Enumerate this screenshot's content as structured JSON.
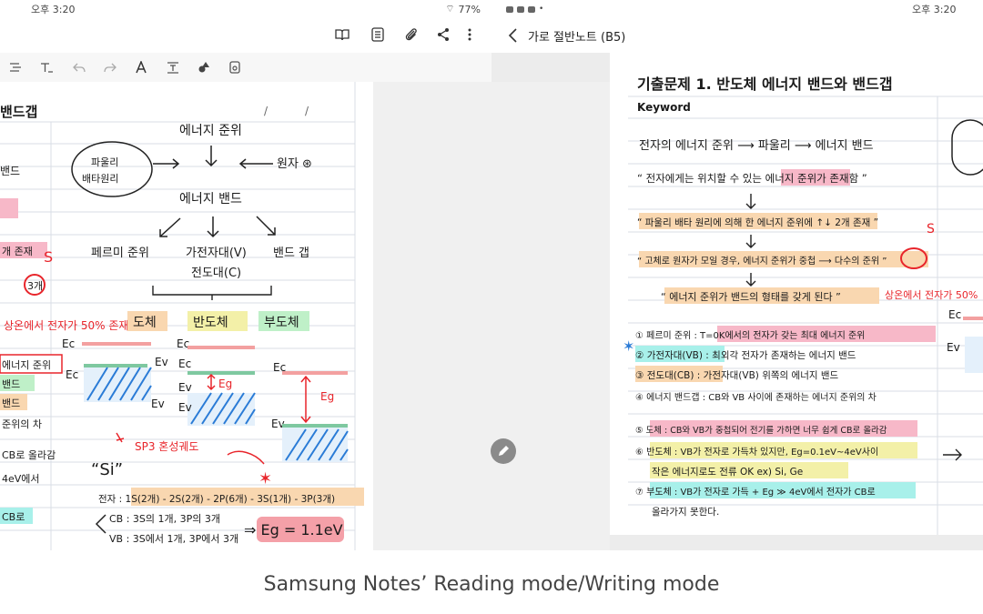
{
  "status_left": {
    "time": "오후 3:20",
    "battery": "77%"
  },
  "status_right": {
    "time": "오후 3:20"
  },
  "note_title": "가로 절반노트 (B5)",
  "left_page": {
    "title_fragment": "밴드갭",
    "energy_level": "에너지 준위",
    "pauli": "파울리\n배타원리",
    "atom": "원자 ⊛",
    "energy_band": "에너지 밴드",
    "fermi": "페르미 준위",
    "valence": "가전자대(V)",
    "conduction": "전도대(C)",
    "bandgap": "밴드 갭",
    "conductor": "도체",
    "semiconductor": "반도체",
    "insulator": "부도체",
    "room_temp": "상온에서 전자가 50% 존재",
    "ec": "Ec",
    "ev": "Ev",
    "eg": "Eg",
    "sp3": "SP3 혼성궤도",
    "si": "“Si”",
    "electron_config": "전자 : 1S(2개) - 2S(2개) - 2P(6개) - 3S(1개) - 3P(3개)",
    "cb_line": "CB : 3S의 1개, 3P의 3개",
    "vb_line": "VB : 3S에서 1개, 3P에서 3개",
    "eg_value": "⇒ Eg = 1.1eV",
    "frag_1": "밴드",
    "frag_2": "개 존재",
    "frag_3": "3개",
    "frag_4": "에너지 준위",
    "frag_5": "밴드",
    "frag_6": "밴드",
    "frag_7": "준위의 차",
    "frag_8": "CB로 올라감",
    "frag_9": "4eV에서",
    "frag_10": "CB로"
  },
  "right_page": {
    "heading": "기출문제 1. 반도체 에너지 밴드와 밴드갭",
    "keyword": "Keyword",
    "line1": "전자의 에너지 준위 ⟶ 파울리 ⟶ 에너지 밴드",
    "line2": "“ 전자에게는 위치할 수 있는 에너지 준위가 존재함 ”",
    "line3": "“ 파울리 배타 원리에 의해 한 에너지 준위에 ↑↓ 2개 존재 ”",
    "line4": "“ 고체로 원자가 모일 경우, 에너지 준위가 중첩 ⟶ 다수의 준위 ”",
    "line5": "“ 에너지 준위가 밴드의 형태를 갖게 된다 ”",
    "room_temp": "상온에서 전자가 50%",
    "item1": "① 페르미 준위 : T=0K에서의 전자가 갖는 최대 에너지 준위",
    "item2": "② 가전자대(VB) : 최외각 전자가 존재하는 에너지 밴드",
    "item3": "③ 전도대(CB) : 가전자대(VB) 위쪽의 에너지 밴드",
    "item4": "④ 에너지 밴드갭 : CB와 VB 사이에 존재하는 에너지 준위의 차",
    "item5": "⑤ 도체 : CB와 VB가 중첩되어 전기를 가하면 너무 쉽게 CB로 올라감",
    "item6": "⑥ 반도체 : VB가 전자로 가득차 있지만, Eg=0.1eV~4eV사이",
    "item6b": "작은 에너지로도 전류 OK   ex) Si, Ge",
    "item7": "⑦ 부도체 : VB가 전자로 가득 + Eg ≫ 4eV에서 전자가 CB로",
    "item7b": "올라가지 못한다.",
    "ec": "Ec",
    "ev": "Ev"
  },
  "caption": "Samsung Notes’ Reading mode/Writing mode",
  "colors": {
    "orange_hl": "#f9d7b0",
    "green_hl": "#bff0c8",
    "cyan_hl": "#a8f0ea",
    "pink_hl": "#f7b8c8",
    "yellow_hl": "#f3f0a8",
    "red_ink": "#e8252b",
    "blue_hatch": "#2a7bd6",
    "rule_line": "#d8dde6"
  }
}
